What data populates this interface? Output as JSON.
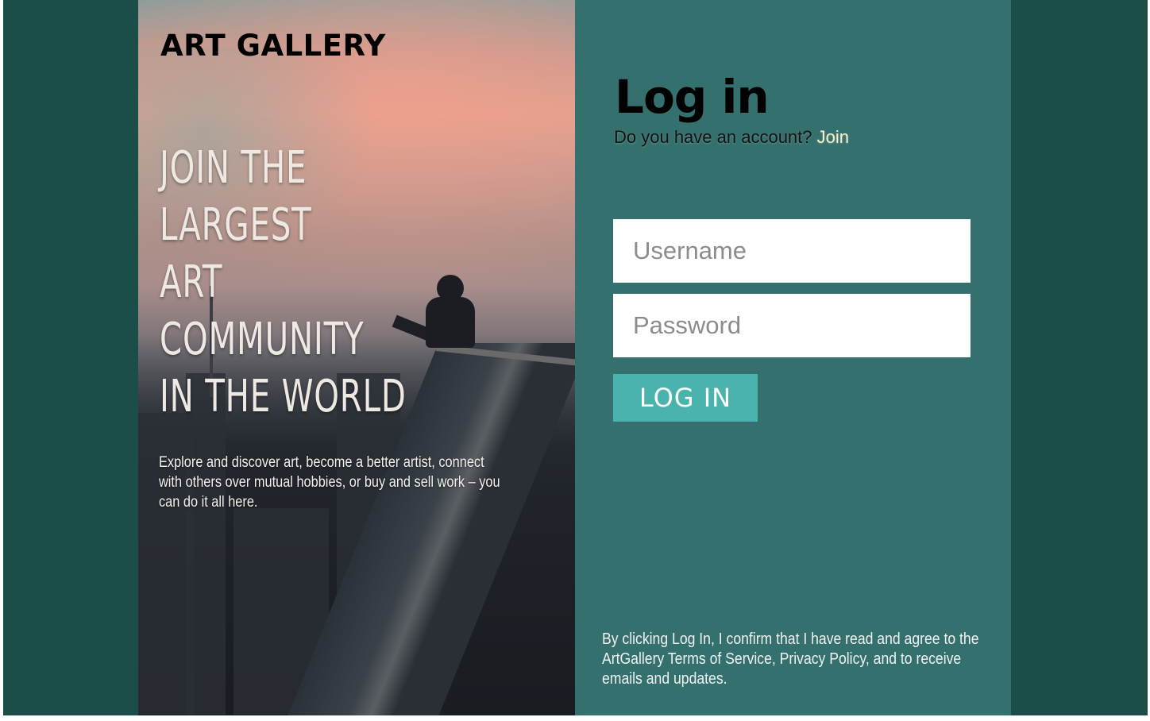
{
  "brand": {
    "logo_text": "ART GALLERY"
  },
  "hero": {
    "headline_lines": [
      "JOIN THE",
      "LARGEST",
      "ART",
      "COMMUNITY",
      "IN THE WORLD"
    ],
    "description": "Explore and discover art, become a better artist, connect with others over mutual hobbies, or buy and sell work – you can do it all here."
  },
  "login": {
    "title": "Log in",
    "account_prompt": "Do you have an account?",
    "join_link": "Join",
    "username_placeholder": "Username",
    "password_placeholder": "Password",
    "submit_label": "LOG IN",
    "terms": "By clicking Log In, I confirm that I have read and agree to the ArtGallery Terms of Service, Privacy Policy, and to receive emails and updates."
  },
  "colors": {
    "outer_background": "#1b4e48",
    "panel_background": "#34706d",
    "button_background": "#4bb3ad",
    "join_link": "#f6f0c8"
  }
}
